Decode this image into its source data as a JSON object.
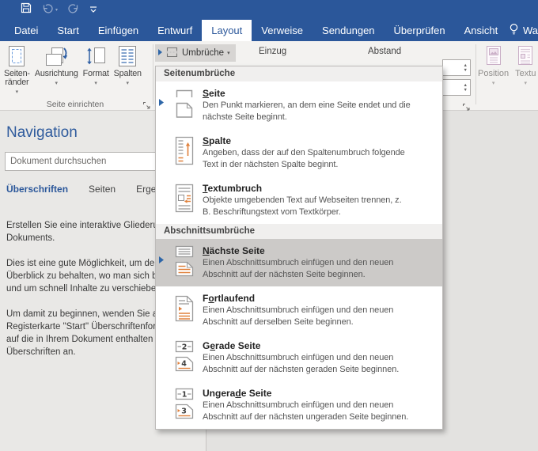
{
  "colors": {
    "accent_blue": "#2b579a",
    "menu_highlight": "#cccac8",
    "icon_orange": "#e0813c",
    "ribbon_bg": "#f3f2f0"
  },
  "titlebar": {
    "quick_access": [
      "save",
      "undo",
      "redo",
      "customize-quick-access-toolbar"
    ]
  },
  "tab_bar": {
    "tabs": [
      {
        "label": "Datei",
        "active": false
      },
      {
        "label": "Start",
        "active": false
      },
      {
        "label": "Einfügen",
        "active": false
      },
      {
        "label": "Entwurf",
        "active": false
      },
      {
        "label": "Layout",
        "active": true
      },
      {
        "label": "Verweise",
        "active": false
      },
      {
        "label": "Sendungen",
        "active": false
      },
      {
        "label": "Überprüfen",
        "active": false
      },
      {
        "label": "Ansicht",
        "active": false
      }
    ],
    "tell_me": "Wa"
  },
  "ribbon": {
    "page_setup_group": {
      "label": "Seite einrichten",
      "buttons": [
        {
          "name": "seitenraender",
          "lines": [
            "Seiten-",
            "ränder"
          ],
          "icon": "margins"
        },
        {
          "name": "ausrichtung",
          "lines": [
            "Ausrichtung"
          ],
          "icon": "orientation"
        },
        {
          "name": "format",
          "lines": [
            "Format"
          ],
          "icon": "size"
        },
        {
          "name": "spalten",
          "lines": [
            "Spalten"
          ],
          "icon": "columns"
        }
      ]
    },
    "breaks_button": {
      "label": "Umbrüche",
      "icon": "breaks"
    },
    "paragraph_group": {
      "einzug_label": "Einzug",
      "abstand_label": "Abstand"
    },
    "arrange_group": {
      "buttons": [
        {
          "name": "position",
          "label": "Position",
          "icon": "position",
          "disabled": true
        },
        {
          "name": "textumbruch",
          "label": "Textu",
          "icon": "wraptext",
          "disabled": true
        }
      ]
    }
  },
  "navigation_pane": {
    "title": "Navigation",
    "search_placeholder": "Dokument durchsuchen",
    "tabs": [
      {
        "label": "Überschriften",
        "active": true
      },
      {
        "label": "Seiten",
        "active": false
      },
      {
        "label": "Ergeb",
        "active": false
      }
    ],
    "paragraphs": [
      [
        "Erstellen Sie eine interaktive Gliederun",
        "Dokuments."
      ],
      [
        "Dies ist eine gute Möglichkeit, um de",
        "Überblick zu behalten, wo man sich b",
        "und um schnell Inhalte zu verschiebe"
      ],
      [
        "Um damit zu beginnen, wenden Sie a",
        "Registerkarte \"Start\" Überschriftenfor",
        "auf die in Ihrem Dokument enthalten",
        "Überschriften an."
      ]
    ]
  },
  "breaks_menu": {
    "sections": [
      {
        "header": "Seitenumbrüche",
        "items": [
          {
            "title": "Seite",
            "accel": 0,
            "icon": "page-break",
            "marker": true,
            "highlighted": false,
            "desc_lines": [
              "Den Punkt markieren, an dem eine Seite endet und die",
              "nächste Seite beginnt."
            ]
          },
          {
            "title": "Spalte",
            "accel": 0,
            "icon": "column-break",
            "marker": false,
            "highlighted": false,
            "desc_lines": [
              "Angeben, dass der auf den Spaltenumbruch folgende",
              "Text in der nächsten Spalte beginnt."
            ]
          },
          {
            "title": "Textumbruch",
            "accel": 0,
            "icon": "text-wrap",
            "marker": false,
            "highlighted": false,
            "desc_lines": [
              "Objekte umgebenden Text auf Webseiten trennen, z.",
              "B. Beschriftungstext vom Textkörper."
            ]
          }
        ]
      },
      {
        "header": "Abschnittsumbrüche",
        "items": [
          {
            "title": "Nächste Seite",
            "accel": 0,
            "icon": "next-page",
            "marker": true,
            "highlighted": true,
            "desc_lines": [
              "Einen Abschnittsumbruch einfügen und den neuen",
              "Abschnitt auf der nächsten Seite beginnen."
            ]
          },
          {
            "title": "Fortlaufend",
            "accel": 1,
            "icon": "continuous",
            "marker": false,
            "highlighted": false,
            "desc_lines": [
              "Einen Abschnittsumbruch einfügen und den neuen",
              "Abschnitt auf derselben Seite beginnen."
            ]
          },
          {
            "title": "Gerade Seite",
            "accel": 1,
            "icon": "even-page",
            "marker": false,
            "highlighted": false,
            "desc_lines": [
              "Einen Abschnittsumbruch einfügen und den neuen",
              "Abschnitt auf der nächsten geraden Seite beginnen."
            ]
          },
          {
            "title": "Ungerade Seite",
            "accel": 6,
            "icon": "odd-page",
            "marker": false,
            "highlighted": false,
            "desc_lines": [
              "Einen Abschnittsumbruch einfügen und den neuen",
              "Abschnitt auf der nächsten ungeraden Seite beginnen."
            ]
          }
        ]
      }
    ]
  }
}
